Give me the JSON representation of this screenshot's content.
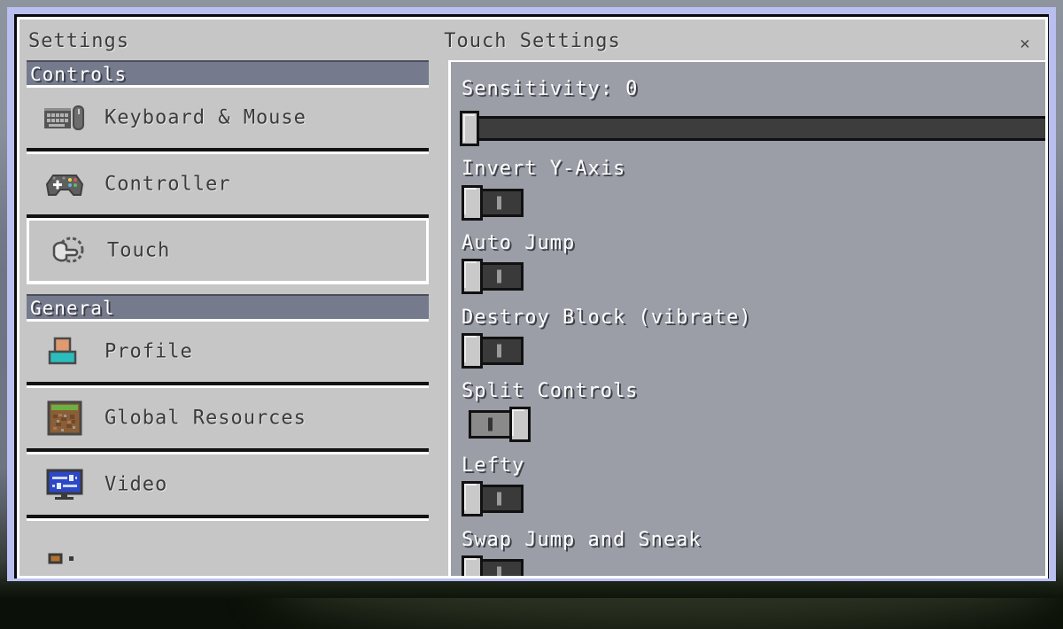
{
  "window": {
    "title": "Settings",
    "panel_title": "Touch Settings",
    "close_label": "✕"
  },
  "sidebar": {
    "sections": [
      {
        "header": "Controls",
        "items": [
          {
            "label": "Keyboard & Mouse",
            "icon": "keyboard-mouse-icon",
            "selected": false
          },
          {
            "label": "Controller",
            "icon": "gamepad-icon",
            "selected": false
          },
          {
            "label": "Touch",
            "icon": "touch-hand-icon",
            "selected": true
          }
        ]
      },
      {
        "header": "General",
        "items": [
          {
            "label": "Profile",
            "icon": "player-profile-icon",
            "selected": false
          },
          {
            "label": "Global Resources",
            "icon": "grass-block-icon",
            "selected": false
          },
          {
            "label": "Video",
            "icon": "monitor-sliders-icon",
            "selected": false
          },
          {
            "label": "",
            "icon": "partial-icon",
            "selected": false
          }
        ]
      }
    ]
  },
  "touch_settings": {
    "slider": {
      "label": "Sensitivity: 0",
      "value": 0,
      "min": 0,
      "max": 100
    },
    "toggles": [
      {
        "label": "Invert Y-Axis",
        "state": "off"
      },
      {
        "label": "Auto Jump",
        "state": "off"
      },
      {
        "label": "Destroy Block (vibrate)",
        "state": "off"
      },
      {
        "label": "Split Controls",
        "state": "on"
      },
      {
        "label": "Lefty",
        "state": "off"
      },
      {
        "label": "Swap Jump and Sneak",
        "state": "off"
      }
    ]
  },
  "colors": {
    "panel_bg": "#c6c6c6",
    "section_header": "#757a8c",
    "window_edge": "#b9c0f0",
    "text_dark": "#3b3b3b",
    "text_light": "#ffffff"
  }
}
